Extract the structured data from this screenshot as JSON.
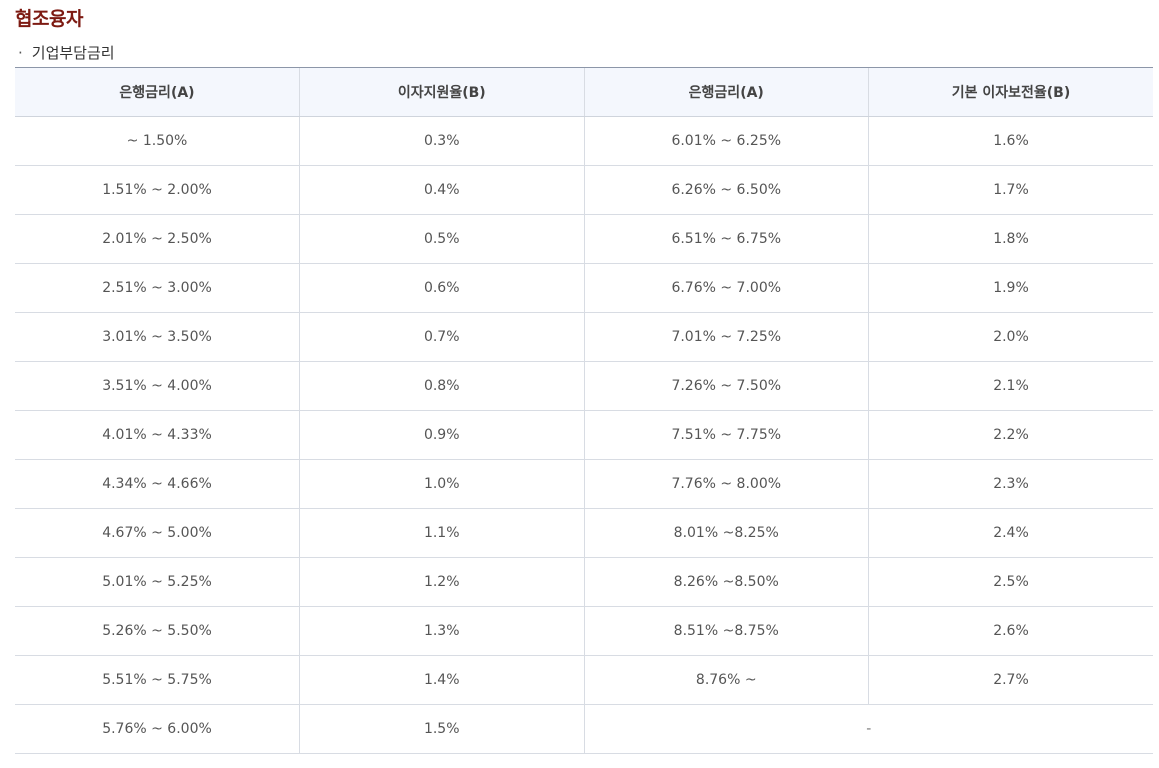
{
  "page": {
    "title": "협조융자",
    "subtitle_bullet": "·",
    "subtitle": "기업부담금리"
  },
  "table": {
    "headers": [
      "은행금리(A)",
      "이자지원율(B)",
      "은행금리(A)",
      "기본 이자보전율(B)"
    ],
    "rows": [
      [
        "~ 1.50%",
        "0.3%",
        "6.01% ~ 6.25%",
        "1.6%"
      ],
      [
        "1.51% ~ 2.00%",
        "0.4%",
        "6.26% ~ 6.50%",
        "1.7%"
      ],
      [
        "2.01% ~ 2.50%",
        "0.5%",
        "6.51% ~ 6.75%",
        "1.8%"
      ],
      [
        "2.51% ~ 3.00%",
        "0.6%",
        "6.76% ~ 7.00%",
        "1.9%"
      ],
      [
        "3.01% ~ 3.50%",
        "0.7%",
        "7.01% ~ 7.25%",
        "2.0%"
      ],
      [
        "3.51% ~ 4.00%",
        "0.8%",
        "7.26% ~ 7.50%",
        "2.1%"
      ],
      [
        "4.01% ~ 4.33%",
        "0.9%",
        "7.51% ~ 7.75%",
        "2.2%"
      ],
      [
        "4.34% ~ 4.66%",
        "1.0%",
        "7.76% ~ 8.00%",
        "2.3%"
      ],
      [
        "4.67% ~ 5.00%",
        "1.1%",
        "8.01% ~8.25%",
        "2.4%"
      ],
      [
        "5.01% ~ 5.25%",
        "1.2%",
        "8.26% ~8.50%",
        "2.5%"
      ],
      [
        "5.26% ~ 5.50%",
        "1.3%",
        "8.51% ~8.75%",
        "2.6%"
      ],
      [
        "5.51% ~ 5.75%",
        "1.4%",
        "8.76% ~",
        "2.7%"
      ]
    ],
    "last_row": {
      "rate": "5.76% ~ 6.00%",
      "support": "1.5%",
      "merged": "-"
    }
  }
}
